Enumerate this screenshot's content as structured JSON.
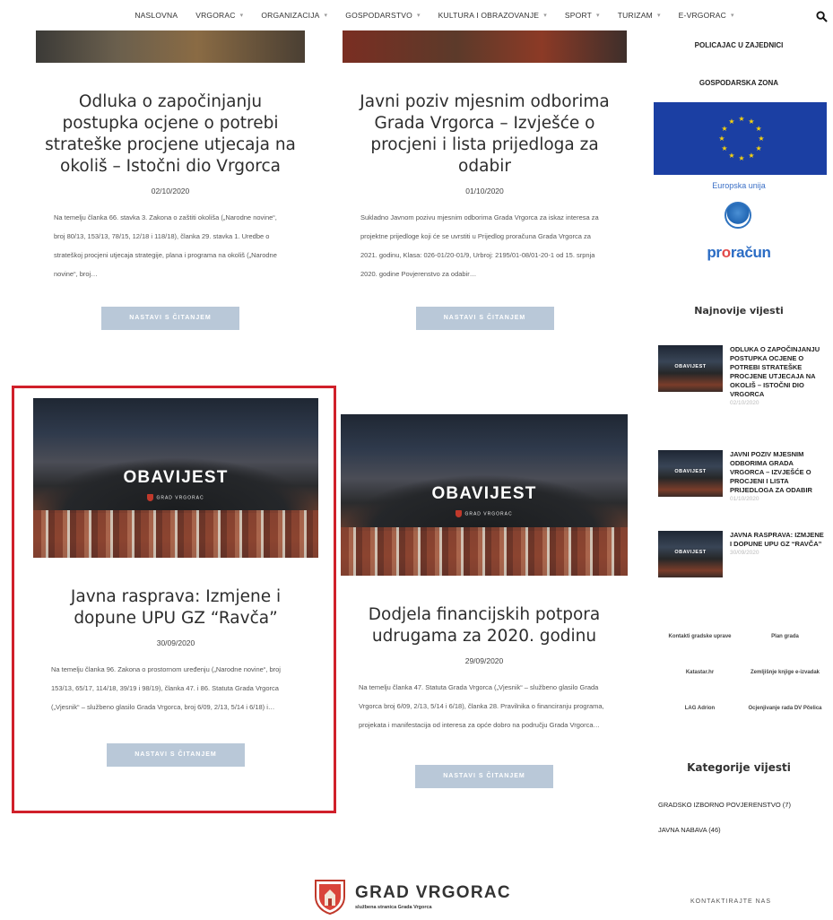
{
  "nav": {
    "items": [
      {
        "label": "NASLOVNA",
        "caret": false
      },
      {
        "label": "VRGORAC",
        "caret": true
      },
      {
        "label": "ORGANIZACIJA",
        "caret": true
      },
      {
        "label": "GOSPODARSTVO",
        "caret": true
      },
      {
        "label": "KULTURA I OBRAZOVANJE",
        "caret": true
      },
      {
        "label": "SPORT",
        "caret": true
      },
      {
        "label": "TURIZAM",
        "caret": true
      },
      {
        "label": "E-VRGORAC",
        "caret": true
      }
    ],
    "caret_glyph": "▾"
  },
  "posts": [
    {
      "title": "Odluka o započinjanju postupka ocjene o potrebi strateške procjene utjecaja na okoliš – Istočni dio Vrgorca",
      "date": "02/10/2020",
      "excerpt": "Na temelju članka 66. stavka 3. Zakona o zaštiti okoliša („Narodne novine“, broj 80/13, 153/13, 78/15, 12/18 i 118/18), članka 29. stavka 1. Uredbe o strateškoj procjeni utjecaja strategije, plana i programa na okoliš („Narodne novine“, broj…",
      "more": "NASTAVI S ČITANJEM"
    },
    {
      "title": "Javni poziv mjesnim odborima Grada Vrgorca – Izvješće o procjeni i lista prijedloga za odabir",
      "date": "01/10/2020",
      "excerpt": "Sukladno Javnom pozivu mjesnim odborima Grada Vrgorca za iskaz interesa za projektne prijedloge koji će se uvrstiti u Prijedlog proračuna Grada Vrgorca za 2021. godinu, Klasa: 026-01/20-01/9, Urbroj: 2195/01-08/01-20-1 od 15. srpnja 2020. godine Povjerenstvo za odabir…",
      "more": "NASTAVI S ČITANJEM"
    },
    {
      "image_label": "OBAVIJEST",
      "image_sub": "GRAD VRGORAC",
      "title": "Javna rasprava: Izmjene i dopune UPU GZ “Ravča”",
      "date": "30/09/2020",
      "excerpt": "Na temelju članka 96. Zakona o prostornom uređenju („Narodne novine“, broj 153/13, 65/17, 114/18, 39/19 i 98/19), članka 47. i 86. Statuta Grada Vrgorca („Vjesnik“ – službeno glasilo Grada Vrgorca, broj 6/09, 2/13, 5/14 i 6/18) i…",
      "more": "NASTAVI S ČITANJEM"
    },
    {
      "image_label": "OBAVIJEST",
      "image_sub": "GRAD VRGORAC",
      "title": "Dodjela financijskih potpora udrugama za 2020. godinu",
      "date": "29/09/2020",
      "excerpt": "Na temelju članka 47. Statuta Grada Vrgorca („Vjesnik“ – službeno glasilo Grada Vrgorca broj 6/09, 2/13, 5/14 i 6/18), članka 28. Pravilnika o financiranju programa, projekata i manifestacija od interesa za opće dobro na području Grada Vrgorca…",
      "more": "NASTAVI S ČITANJEM"
    }
  ],
  "sidebar": {
    "links": [
      "POLICAJAC U ZAJEDNICI",
      "GOSPODARSKA ZONA"
    ],
    "eu_caption": "Europska unija",
    "proracun": {
      "pre": "pr",
      "o": "o",
      "post": "račun"
    },
    "recent_heading": "Najnovije vijesti",
    "recent_thumb_label": "OBAVIJEST",
    "recent": [
      {
        "title": "ODLUKA O ZAPOČINJANJU POSTUPKA OCJENE O POTREBI STRATEŠKE PROCJENE UTJECAJA NA OKOLIŠ – ISTOČNI DIO VRGORCA",
        "date": "02/10/2020"
      },
      {
        "title": "JAVNI POZIV MJESNIM ODBORIMA GRADA VRGORCA – IZVJEŠĆE O PROCJENI I LISTA PRIJEDLOGA ZA ODABIR",
        "date": "01/10/2020"
      },
      {
        "title": "JAVNA RASPRAVA: IZMJENE I DOPUNE UPU GZ “RAVČA”",
        "date": "30/09/2020"
      }
    ],
    "grid_links": [
      "Kontakti gradske uprave",
      "Plan grada",
      "Katastar.hr",
      "Zemljišnje knjige e-izvadak",
      "LAG Adrion",
      "Ocjenjivanje rada DV Pčelica"
    ],
    "categories_heading": "Kategorije vijesti",
    "categories": [
      "GRADSKO IZBORNO POVJERENSTVO (7)",
      "JAVNA NABAVA (46)"
    ]
  },
  "footer": {
    "name": "GRAD VRGORAC",
    "tagline": "službena stranica Grada Vrgorca",
    "contact": "KONTAKTIRAJTE NAS"
  },
  "colors": {
    "accent_red": "#d0202a",
    "button": "#b9c8d8",
    "eu_blue": "#1b3fa3",
    "eu_star": "#f5d10f"
  }
}
